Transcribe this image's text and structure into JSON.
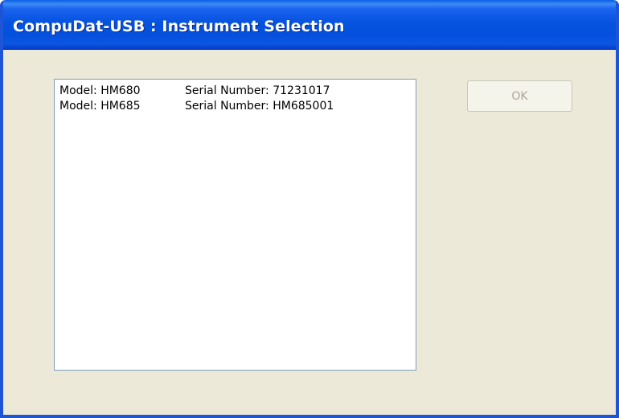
{
  "window": {
    "title": "CompuDat-USB : Instrument Selection"
  },
  "instrument_list": {
    "items": [
      {
        "model": "Model:  HM680",
        "serial": "Serial Number:  71231017"
      },
      {
        "model": "Model:  HM685",
        "serial": "Serial Number:  HM685001"
      }
    ]
  },
  "buttons": {
    "ok_label": "OK",
    "ok_enabled": false
  },
  "colors": {
    "titlebar": "#0553e0",
    "window_bg": "#ece9d8",
    "list_border": "#7f9db9",
    "disabled_text": "#aca899"
  }
}
